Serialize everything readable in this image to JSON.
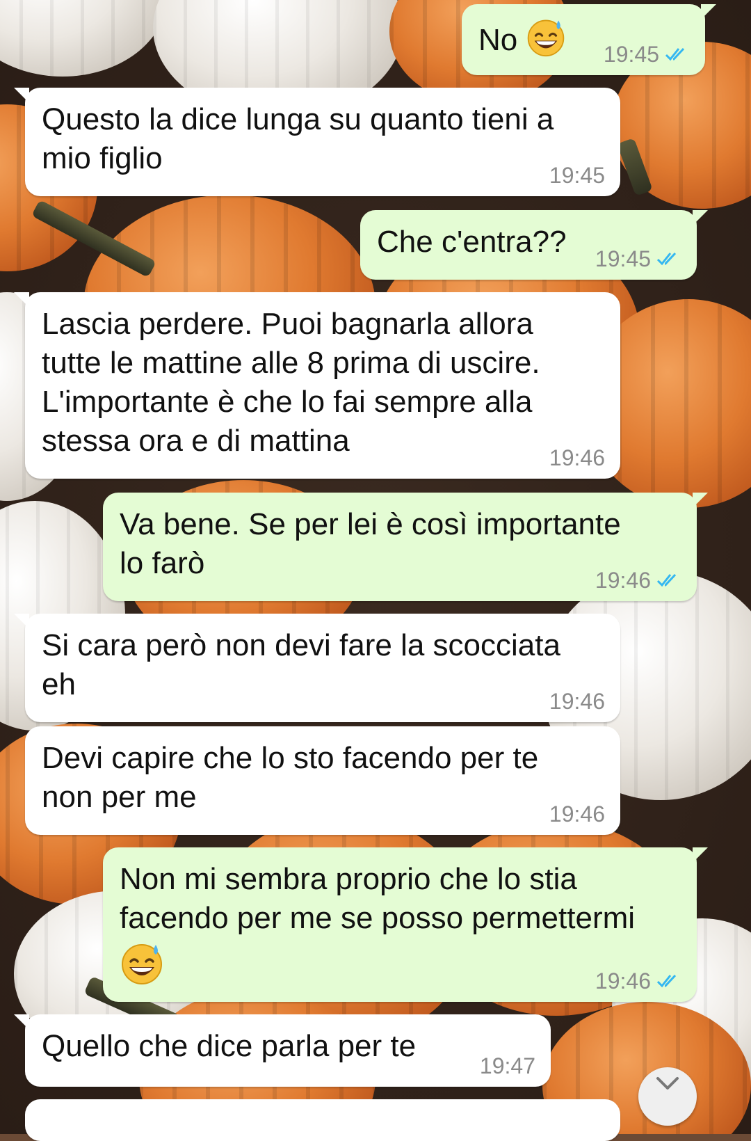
{
  "messages": [
    {
      "id": "m1",
      "direction": "out",
      "text": "No",
      "emoji": "grinning-face-with-sweat-icon",
      "time": "19:45",
      "status": "read"
    },
    {
      "id": "m2",
      "direction": "in",
      "text": "Questo la dice lunga su quanto tieni a\nmio figlio",
      "time": "19:45"
    },
    {
      "id": "m3",
      "direction": "out",
      "text": "Che c'entra??",
      "time": "19:45",
      "status": "read"
    },
    {
      "id": "m4",
      "direction": "in",
      "text": "Lascia perdere. Puoi bagnarla allora\ntutte le mattine alle 8 prima di uscire.\nL'importante è che lo fai sempre alla\nstessa ora e di mattina",
      "time": "19:46"
    },
    {
      "id": "m5",
      "direction": "out",
      "text": "Va bene. Se per lei è così importante\nlo farò",
      "time": "19:46",
      "status": "read"
    },
    {
      "id": "m6",
      "direction": "in",
      "text": "Si cara però non devi fare la scocciata\neh",
      "time": "19:46"
    },
    {
      "id": "m7",
      "direction": "in",
      "text": "Devi capire che lo sto facendo per te\nnon per me",
      "time": "19:46"
    },
    {
      "id": "m8",
      "direction": "out",
      "text": "Non mi sembra proprio che lo stia\nfacendo per me se posso permettermi",
      "emoji": "grinning-face-with-sweat-icon",
      "time": "19:46",
      "status": "read"
    },
    {
      "id": "m9",
      "direction": "in",
      "text": "Quello che dice parla per te",
      "time": "19:47"
    }
  ],
  "colors": {
    "incoming_bubble": "#ffffff",
    "outgoing_bubble": "#e4fcd4",
    "timestamp": "#8a8a8a",
    "read_ticks": "#34b7f1"
  },
  "icons": {
    "read_receipt": "double-check-icon",
    "scroll_down": "chevron-down-icon"
  }
}
